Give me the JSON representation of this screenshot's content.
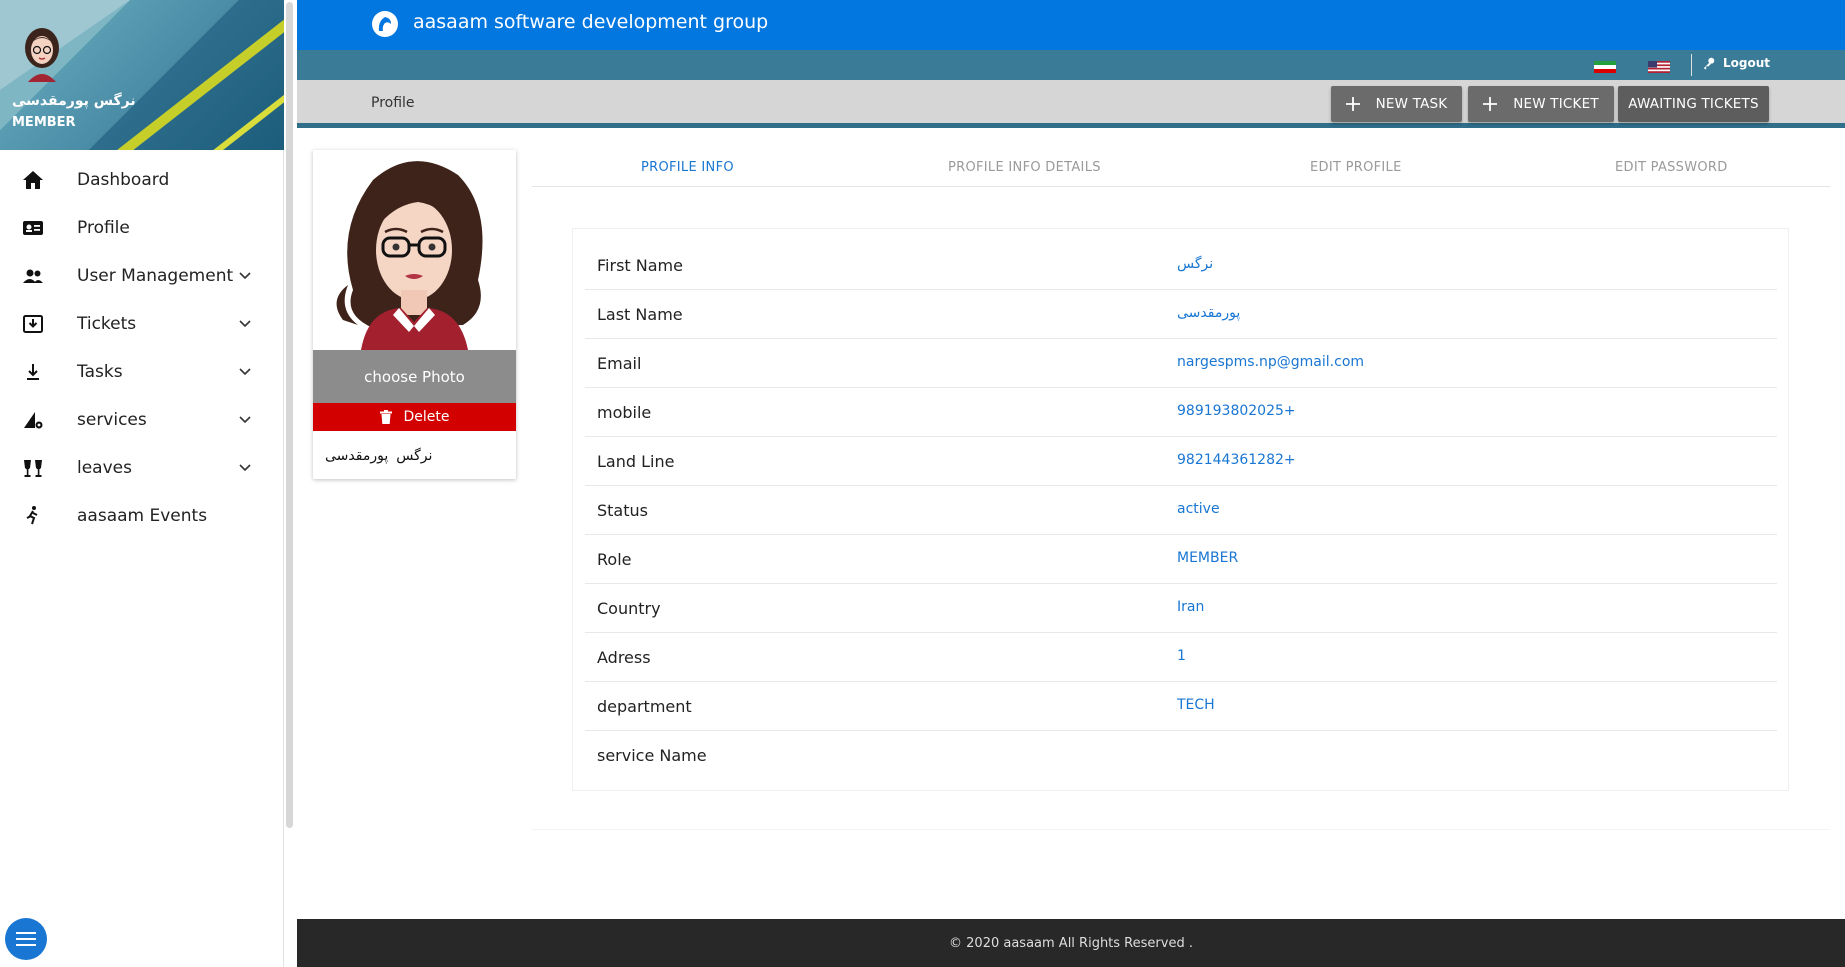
{
  "app": {
    "title": "aasaam software development group"
  },
  "user": {
    "name": "نرگس پورمقدسی",
    "role": "MEMBER",
    "first_name": "نرگس",
    "last_name": "پورمقدسی"
  },
  "sidebar": {
    "items": [
      {
        "label": "Dashboard",
        "icon": "home-icon",
        "expandable": false
      },
      {
        "label": "Profile",
        "icon": "id-card-icon",
        "expandable": false
      },
      {
        "label": "User Management",
        "icon": "users-icon",
        "expandable": true
      },
      {
        "label": "Tickets",
        "icon": "inbox-download-icon",
        "expandable": true
      },
      {
        "label": "Tasks",
        "icon": "download-arrow-icon",
        "expandable": true
      },
      {
        "label": "services",
        "icon": "service-gear-icon",
        "expandable": true
      },
      {
        "label": "leaves",
        "icon": "glasses-toast-icon",
        "expandable": true
      },
      {
        "label": "aasaam Events",
        "icon": "running-person-icon",
        "expandable": false
      }
    ]
  },
  "header": {
    "logout_label": "Logout",
    "flags": [
      "iran-flag-icon",
      "usa-flag-icon"
    ]
  },
  "breadcrumb": {
    "current": "Profile"
  },
  "actions": {
    "new_task": "NEW TASK",
    "new_ticket": "NEW TICKET",
    "awaiting_tickets": "AWAITING TICKETS"
  },
  "card": {
    "choose_photo": "choose Photo",
    "delete": "Delete"
  },
  "tabs": [
    "PROFILE INFO",
    "PROFILE INFO DETAILS",
    "EDIT PROFILE",
    "EDIT PASSWORD"
  ],
  "profile_rows": [
    {
      "label": "First Name",
      "value": "نرگس"
    },
    {
      "label": "Last Name",
      "value": "پورمقدسی"
    },
    {
      "label": "Email",
      "value": "nargespms.np@gmail.com"
    },
    {
      "label": "mobile",
      "value": "989193802025+"
    },
    {
      "label": "Land Line",
      "value": "982144361282+"
    },
    {
      "label": "Status",
      "value": "active"
    },
    {
      "label": "Role",
      "value": "MEMBER"
    },
    {
      "label": "Country",
      "value": "Iran"
    },
    {
      "label": "Adress",
      "value": "1"
    },
    {
      "label": "department",
      "value": "TECH"
    },
    {
      "label": "service Name",
      "value": ""
    }
  ],
  "footer": {
    "text": "© 2020 aasaam All Rights Reserved ."
  },
  "colors": {
    "primary": "#0277e0",
    "accent": "#1976d2",
    "danger": "#d30000",
    "footer": "#282828"
  }
}
